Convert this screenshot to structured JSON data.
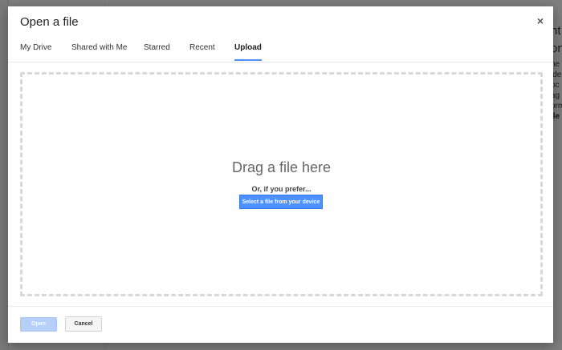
{
  "background": {
    "right_lines": [
      "nt",
      "on",
      "he",
      "ide",
      "oc",
      "ag",
      "orm",
      "ile"
    ]
  },
  "dialog": {
    "title": "Open a file",
    "close_glyph": "×",
    "tabs": [
      {
        "label": "My Drive"
      },
      {
        "label": "Shared with Me"
      },
      {
        "label": "Starred"
      },
      {
        "label": "Recent"
      },
      {
        "label": "Upload",
        "active": true
      }
    ],
    "drop_zone": {
      "title": "Drag a file here",
      "subtitle": "Or, if you prefer...",
      "select_label": "Select a file from your device"
    },
    "footer": {
      "open_label": "Open",
      "cancel_label": "Cancel"
    }
  },
  "colors": {
    "accent": "#4d90fe",
    "accent_disabled": "#b6cff7",
    "overlay": "#7f7f7f"
  },
  "icons": {
    "close": "close-icon"
  }
}
